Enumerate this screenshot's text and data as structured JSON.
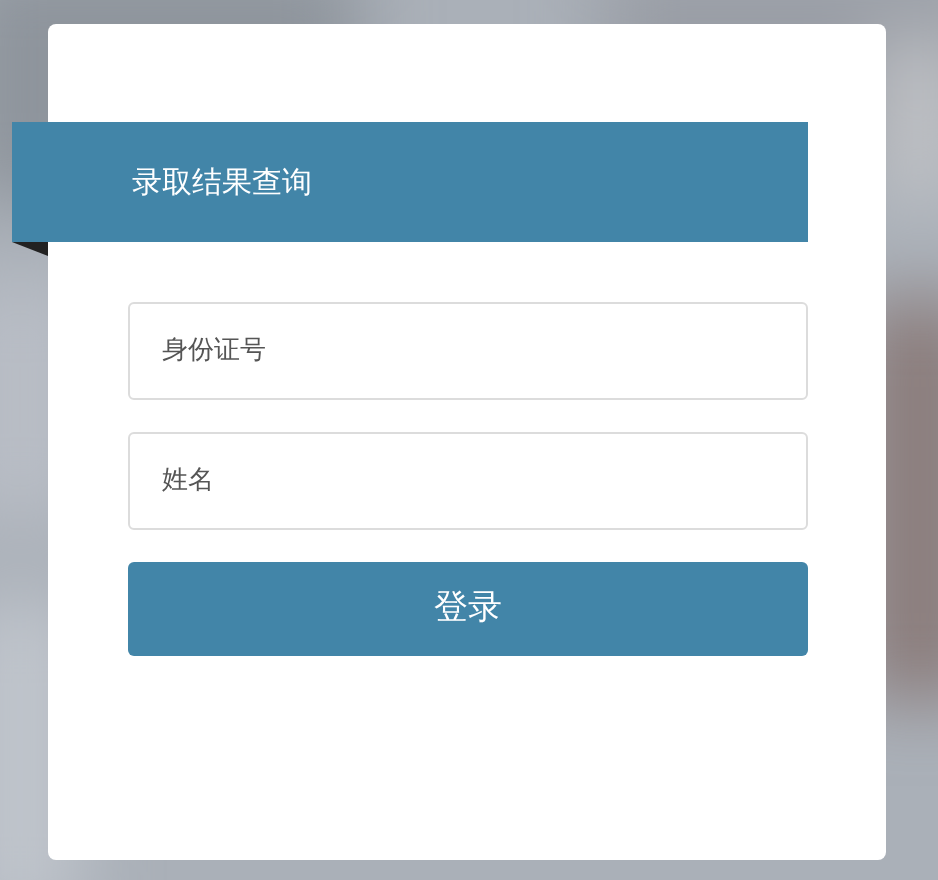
{
  "title": "录取结果查询",
  "fields": [
    {
      "placeholder": "身份证号"
    },
    {
      "placeholder": "姓名"
    }
  ],
  "button": "登录"
}
